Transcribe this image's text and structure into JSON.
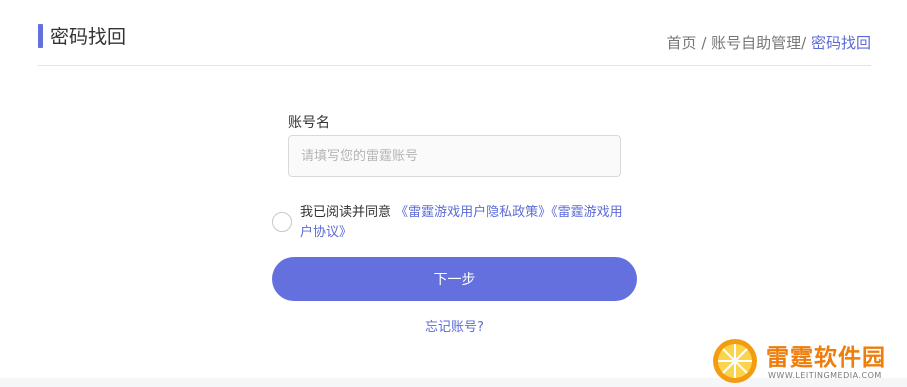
{
  "header": {
    "title": "密码找回",
    "breadcrumb": {
      "home": "首页",
      "sep1": " / ",
      "section": "账号自助管理",
      "sep2": "/ ",
      "current": "密码找回"
    }
  },
  "form": {
    "account_label": "账号名",
    "account_placeholder": "请填写您的雷霆账号",
    "account_value": "",
    "agree_prefix": "我已阅读并同意 ",
    "privacy_link": "《雷霆游戏用户隐私政策》",
    "agreement_link": "《雷霆游戏用户协议》",
    "agree_checked": false,
    "next_label": "下一步",
    "forgot_label": "忘记账号?"
  },
  "watermark": {
    "name": "雷霆软件园",
    "url": "WWW.LEITINGMEDIA.COM"
  },
  "colors": {
    "accent": "#6470dd",
    "link": "#5b6bd6",
    "watermark": "#ef7d0b"
  }
}
